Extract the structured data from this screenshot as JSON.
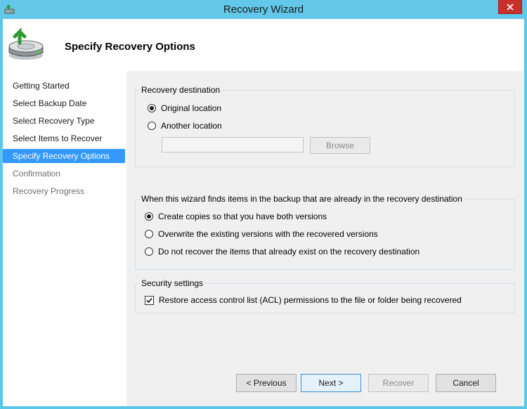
{
  "window": {
    "title": "Recovery Wizard",
    "close_icon": "close-icon"
  },
  "header": {
    "heading": "Specify Recovery Options",
    "icon": "recovery-disk-icon"
  },
  "sidebar": {
    "items": [
      {
        "label": "Getting Started",
        "state": "completed"
      },
      {
        "label": "Select Backup Date",
        "state": "completed"
      },
      {
        "label": "Select Recovery Type",
        "state": "completed"
      },
      {
        "label": "Select Items to Recover",
        "state": "completed"
      },
      {
        "label": "Specify Recovery Options",
        "state": "active"
      },
      {
        "label": "Confirmation",
        "state": "pending"
      },
      {
        "label": "Recovery Progress",
        "state": "pending"
      }
    ]
  },
  "destination": {
    "legend": "Recovery destination",
    "options": [
      {
        "label": "Original location",
        "checked": true
      },
      {
        "label": "Another location",
        "checked": false
      }
    ],
    "path_value": "",
    "browse_label": "Browse"
  },
  "conflict": {
    "legend": "When this wizard finds items in the backup that are already in the recovery destination",
    "options": [
      {
        "label": "Create copies so that you have both versions",
        "checked": true
      },
      {
        "label": "Overwrite the existing versions with the recovered versions",
        "checked": false
      },
      {
        "label": "Do not recover the items that already exist on the recovery destination",
        "checked": false
      }
    ]
  },
  "security": {
    "legend": "Security settings",
    "acl_label": "Restore access control list (ACL) permissions to the file or folder being recovered",
    "acl_checked": true
  },
  "buttons": {
    "previous": "< Previous",
    "next": "Next >",
    "recover": "Recover",
    "cancel": "Cancel"
  },
  "colors": {
    "titlebar": "#62c7e8",
    "accent": "#3399ff",
    "close": "#c7302b"
  }
}
